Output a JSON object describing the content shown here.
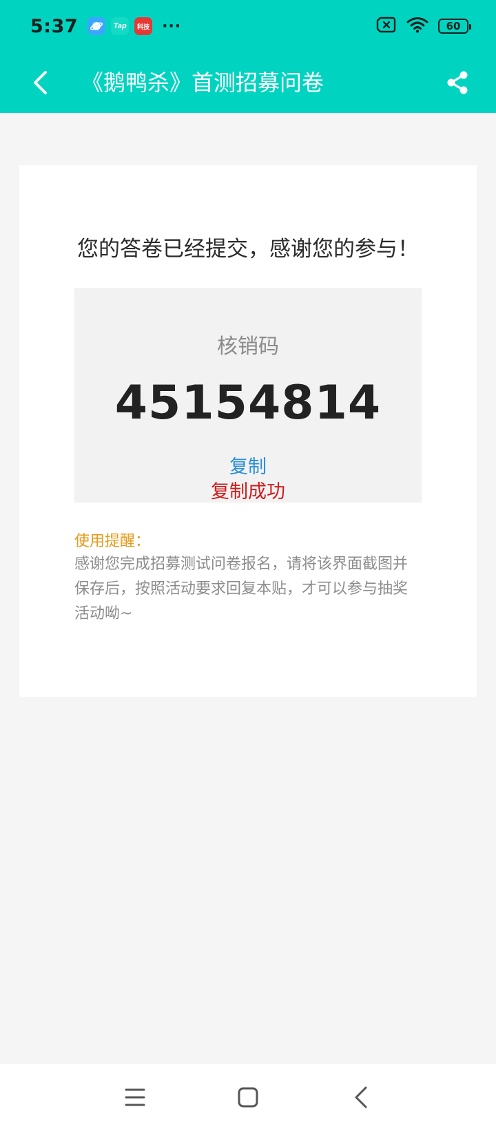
{
  "status_bar": {
    "time": "5:37",
    "apps": [
      {
        "icon": "browser-app-icon",
        "label": ""
      },
      {
        "icon": "taptap-app-icon",
        "label": "Tap"
      },
      {
        "icon": "red-app-icon",
        "label": "科技"
      }
    ],
    "more": "···",
    "battery": "60"
  },
  "header": {
    "title": "《鹅鸭杀》首测招募问卷",
    "accent_color": "#00d4c0"
  },
  "result": {
    "thanks_message": "您的答卷已经提交，感谢您的参与！",
    "code_label": "核销码",
    "code_value": "45154814",
    "copy_label": "复制",
    "copy_success": "复制成功"
  },
  "tips": {
    "title": "使用提醒：",
    "body": "感谢您完成招募测试问卷报名，请将该界面截图并保存后，按照活动要求回复本贴，才可以参与抽奖活动呦~"
  },
  "system_nav": {
    "items": [
      "menu-icon",
      "home-icon",
      "back-icon"
    ]
  }
}
